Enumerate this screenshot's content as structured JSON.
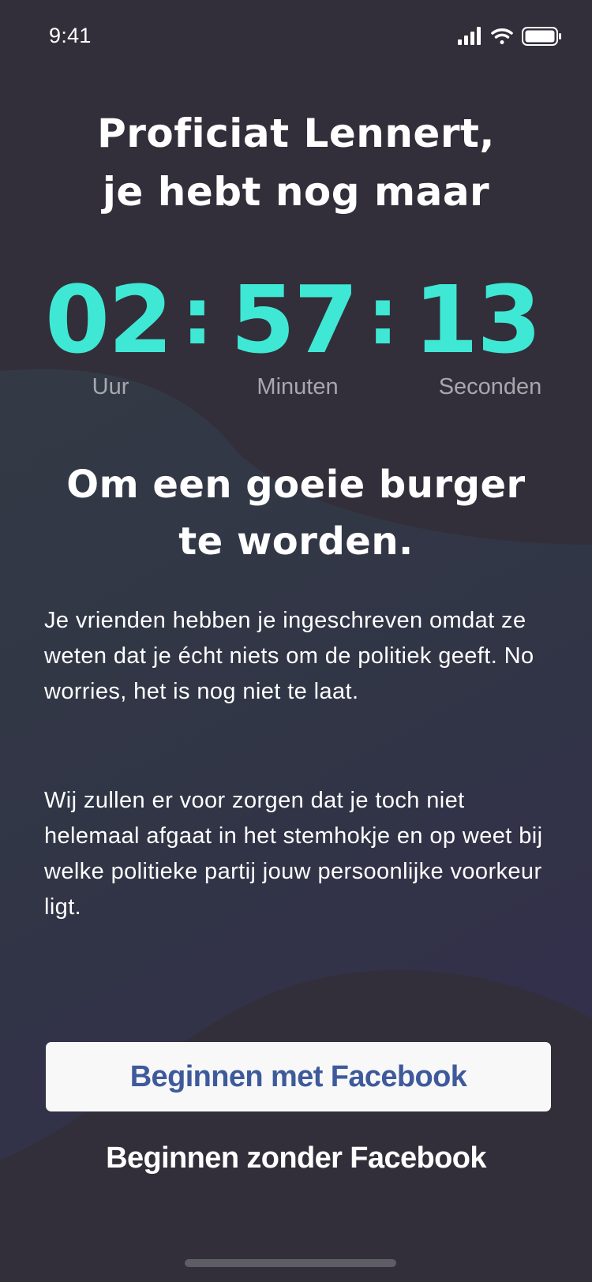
{
  "status_bar": {
    "time": "9:41",
    "icons": [
      "cellular-signal-icon",
      "wifi-icon",
      "battery-icon"
    ]
  },
  "header": {
    "line1": "Proficiat Lennert,",
    "line2": "je hebt nog maar"
  },
  "countdown": {
    "hours": "02",
    "minutes": "57",
    "seconds": "13",
    "separator": ":",
    "hours_label": "Uur",
    "minutes_label": "Minuten",
    "seconds_label": "Seconden"
  },
  "subheading": {
    "line1": "Om een goeie burger",
    "line2": "te worden."
  },
  "body": {
    "paragraph1": "Je vrienden hebben je ingeschreven omdat ze weten dat je écht niets om de politiek geeft. No worries, het is nog niet te laat.",
    "paragraph2": "Wij zullen er voor zorgen dat je toch niet helemaal afgaat in het stemhokje en op weet bij welke politieke partij jouw persoonlijke voorkeur ligt."
  },
  "actions": {
    "facebook_button_label": "Beginnen met Facebook",
    "no_facebook_label": "Beginnen zonder Facebook"
  },
  "colors": {
    "background": "#322f3a",
    "accent": "#3fe8d4",
    "facebook_blue": "#3e5a9b",
    "label_gray": "#a7a7ad"
  }
}
